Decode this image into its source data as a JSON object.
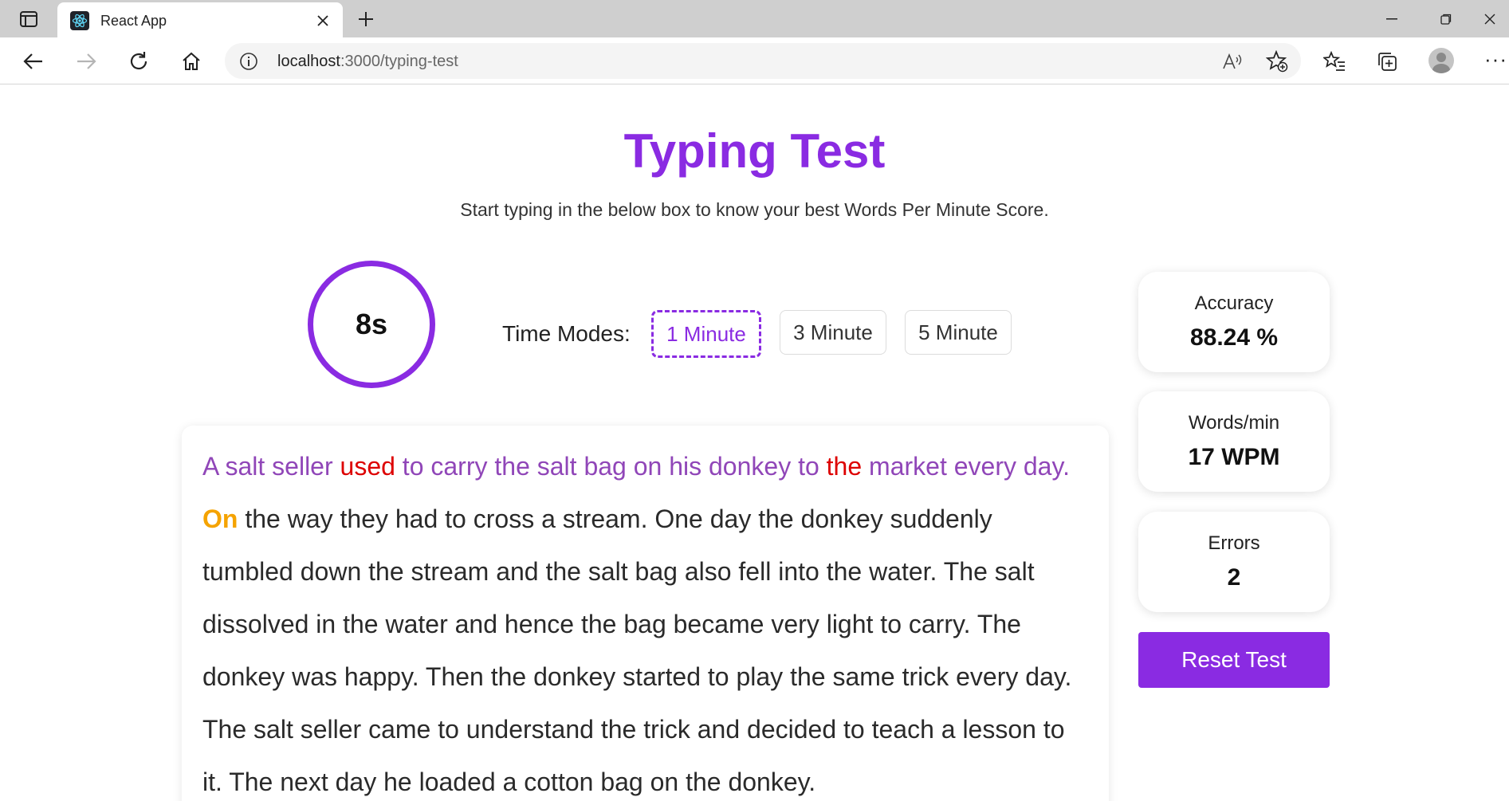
{
  "browser": {
    "tab_title": "React App",
    "url_host": "localhost",
    "url_path": ":3000/typing-test"
  },
  "app": {
    "title": "Typing Test",
    "subtitle": "Start typing in the below box to know your best Words Per Minute Score.",
    "timer": "8s",
    "time_modes_label": "Time Modes:",
    "modes": [
      "1 Minute",
      "3 Minute",
      "5 Minute"
    ],
    "active_mode": "1 Minute",
    "passage": {
      "typed_segments": [
        {
          "text": "A salt seller ",
          "status": "correct"
        },
        {
          "text": "used",
          "status": "error"
        },
        {
          "text": " to carry the salt bag on his donkey to ",
          "status": "correct"
        },
        {
          "text": "the",
          "status": "error"
        },
        {
          "text": " market every day.",
          "status": "correct"
        }
      ],
      "current_word": "On",
      "remaining_text": " the way they had to cross a stream. One day the donkey suddenly tumbled down the stream and the salt bag also fell into the water. The salt dissolved in the water and hence the bag became very light to carry. The donkey was happy. Then the donkey started to play the same trick every day. The salt seller came to understand the trick and decided to teach a lesson to it. The next day he loaded a cotton bag on the donkey."
    },
    "stats": {
      "accuracy_label": "Accuracy",
      "accuracy_value": "88.24 %",
      "wpm_label": "Words/min",
      "wpm_value": "17 WPM",
      "errors_label": "Errors",
      "errors_value": "2"
    },
    "reset_label": "Reset Test",
    "colors": {
      "accent": "#8a2be2",
      "typed_correct": "#9046b8",
      "typed_error": "#dd0000",
      "current_word": "#f5a300"
    }
  }
}
